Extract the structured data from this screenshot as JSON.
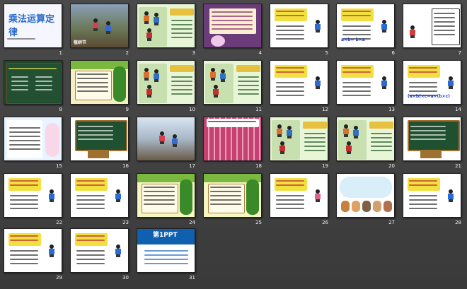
{
  "window": {
    "title": "乘法运算定律"
  },
  "slides": [
    {
      "num": "1",
      "kind": "title",
      "title": "乘法运算定律",
      "bg": "#f6f6ff"
    },
    {
      "num": "2",
      "kind": "photo",
      "caption": "植树节",
      "bg": "#6b8a4a"
    },
    {
      "num": "3",
      "kind": "green",
      "bg": "#e8f6d8"
    },
    {
      "num": "4",
      "kind": "purple",
      "bg": "#6b3b7a"
    },
    {
      "num": "5",
      "kind": "white",
      "bg": "#ffffff"
    },
    {
      "num": "6",
      "kind": "white-boy",
      "formula": "a×b= b×a",
      "bg": "#ffffff"
    },
    {
      "num": "7",
      "kind": "board",
      "bg": "#ffffff"
    },
    {
      "num": "8",
      "kind": "chalk",
      "bg": "#1f4a2a"
    },
    {
      "num": "9",
      "kind": "tree",
      "bg": "#f6f0c0"
    },
    {
      "num": "10",
      "kind": "green",
      "bg": "#e8f6d8"
    },
    {
      "num": "11",
      "kind": "green",
      "bg": "#e8f6d8"
    },
    {
      "num": "12",
      "kind": "white",
      "bg": "#ffffff"
    },
    {
      "num": "13",
      "kind": "white",
      "bg": "#ffffff"
    },
    {
      "num": "14",
      "kind": "white-boy",
      "formula": "(a×b)×c=a×(b×c)",
      "bg": "#ffffff"
    },
    {
      "num": "15",
      "kind": "angel",
      "bg": "#e8f4ff"
    },
    {
      "num": "16",
      "kind": "board-kid",
      "bg": "#ffffff"
    },
    {
      "num": "17",
      "kind": "photo2",
      "bg": "#bcd0e0"
    },
    {
      "num": "18",
      "kind": "building",
      "bg": "#c84070"
    },
    {
      "num": "19",
      "kind": "green",
      "bg": "#e8f6d8"
    },
    {
      "num": "20",
      "kind": "green",
      "bg": "#e8f6d8"
    },
    {
      "num": "21",
      "kind": "board-kid",
      "bg": "#ffffff"
    },
    {
      "num": "22",
      "kind": "white-boy",
      "bg": "#ffffff"
    },
    {
      "num": "23",
      "kind": "white-boy",
      "bg": "#ffffff"
    },
    {
      "num": "24",
      "kind": "tree2",
      "bg": "#f6f6c0"
    },
    {
      "num": "25",
      "kind": "tree2",
      "bg": "#f6f6c0"
    },
    {
      "num": "26",
      "kind": "white-girl",
      "bg": "#ffffff"
    },
    {
      "num": "27",
      "kind": "animals",
      "bg": "#ffffff"
    },
    {
      "num": "28",
      "kind": "white-boy",
      "bg": "#ffffff"
    },
    {
      "num": "29",
      "kind": "white-boy",
      "bg": "#ffffff"
    },
    {
      "num": "30",
      "kind": "white-boy",
      "bg": "#ffffff"
    },
    {
      "num": "31",
      "kind": "ppt",
      "logo": "第1PPT",
      "bg": "#ffffff"
    }
  ],
  "colors": {
    "accent": "#e8b24a",
    "panel": "#444444"
  }
}
